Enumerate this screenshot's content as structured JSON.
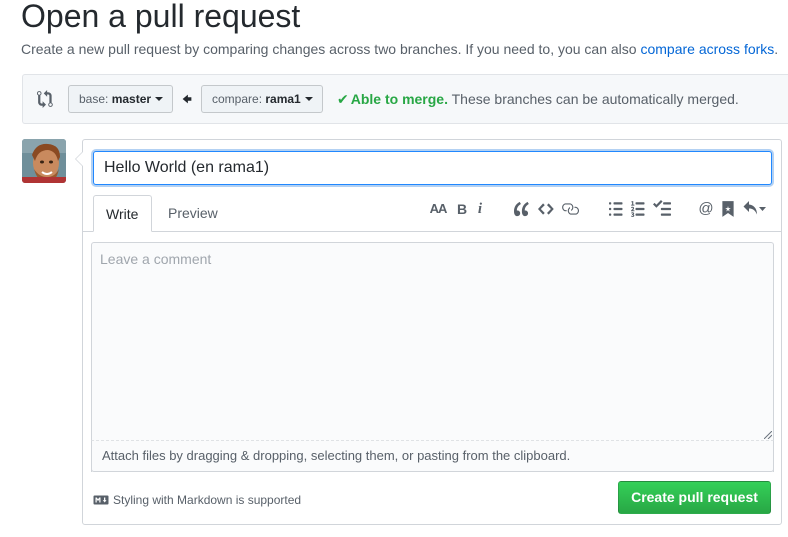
{
  "header": {
    "title": "Open a pull request",
    "subtitle_before": "Create a new pull request by comparing changes across two branches. If you need to, you can also ",
    "subtitle_link": "compare across forks",
    "subtitle_after": "."
  },
  "range": {
    "base_label": "base: ",
    "base_branch": "master",
    "compare_label": "compare: ",
    "compare_branch": "rama1",
    "merge_check": "✔",
    "merge_status": "Able to merge.",
    "merge_message": " These branches can be automatically merged."
  },
  "form": {
    "title_value": "Hello World (en rama1)",
    "tabs": [
      {
        "label": "Write"
      },
      {
        "label": "Preview"
      }
    ],
    "comment_placeholder": "Leave a comment",
    "drop_hint": "Attach files by dragging & dropping, selecting them, or pasting from the clipboard.",
    "markdown_note": "Styling with Markdown is supported",
    "submit_label": "Create pull request"
  },
  "toolbar": {
    "header_glyph": "AA",
    "bold_glyph": "B",
    "italic_glyph": "i",
    "mention_glyph": "@",
    "icons": [
      "header-icon",
      "bold-icon",
      "italic-icon",
      "quote-icon",
      "code-icon",
      "link-icon",
      "bulleted-list-icon",
      "numbered-list-icon",
      "task-list-icon",
      "mention-icon",
      "bookmark-icon",
      "reply-icon"
    ]
  },
  "colors": {
    "accent_link": "#0366d6",
    "success": "#28a745",
    "focus_border": "#2188ff"
  }
}
